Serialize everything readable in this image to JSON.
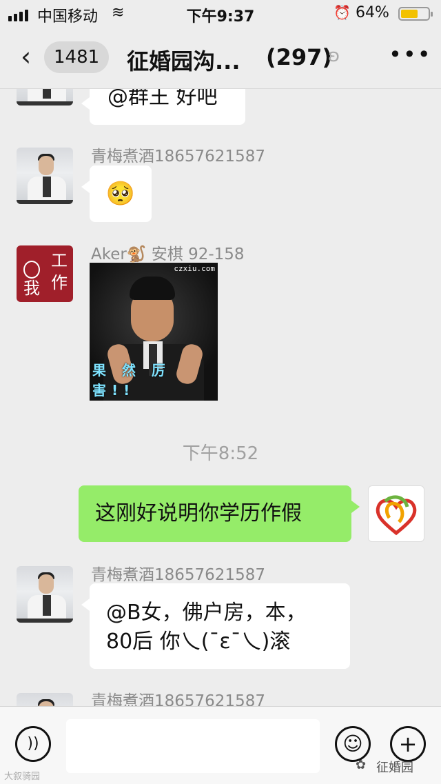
{
  "status_bar": {
    "carrier": "中国移动",
    "time": "下午9:37",
    "battery_percent": "64%",
    "battery_level": 0.64
  },
  "nav": {
    "back_icon": "chevron-left-icon",
    "unread_count": "1481",
    "title": "征婚园沟...",
    "member_count": "(297)",
    "more_icon": "more-dots-icon"
  },
  "messages": [
    {
      "side": "left",
      "sender": "",
      "text": "@群王 好吧"
    },
    {
      "side": "left",
      "sender": "青梅煮酒18657621587",
      "text": "🥺"
    },
    {
      "side": "left",
      "sender": "Aker🐒 安棋 92-158",
      "image_caption": "果 然 厉 害!!",
      "image_watermark": "czxiu.com"
    },
    {
      "side": "right",
      "text": "这刚好说明你学历作假"
    },
    {
      "side": "left",
      "sender": "青梅煮酒18657621587",
      "text_line1": "@B女，佛户房，本，",
      "text_line2": "80后 你乀(ˉεˉ乀)滚"
    },
    {
      "side": "left",
      "sender": "青梅煮酒18657621587"
    }
  ],
  "timestamp": "下午8:52",
  "avatar_work_text": {
    "t1": "工",
    "t2": "作",
    "t3": "我"
  },
  "input_bar": {
    "watermark_left": "大叙骑园",
    "watermark_right": "征婚园"
  }
}
